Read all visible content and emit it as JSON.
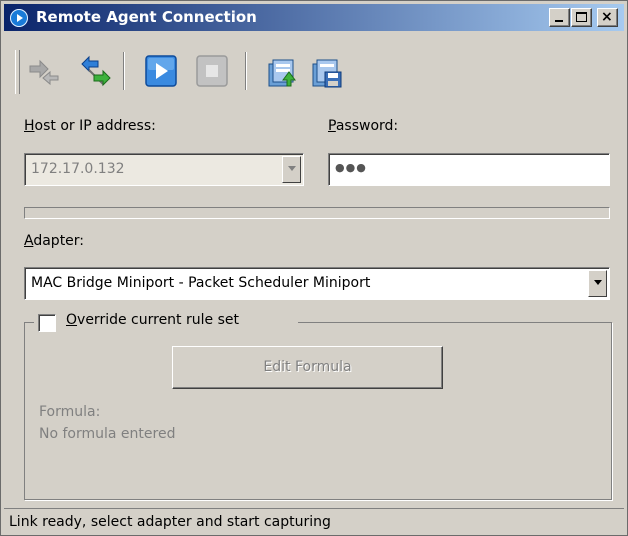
{
  "window": {
    "title": "Remote Agent Connection",
    "title_icon": "remote-agent-icon",
    "controls": {
      "minimize": "minimize-icon",
      "maximize": "maximize-icon",
      "close_glyph": "×"
    }
  },
  "toolbar": {
    "buttons": [
      {
        "name": "disconnect",
        "icon": "disconnect-arrows-icon",
        "enabled": false
      },
      {
        "name": "connect",
        "icon": "connect-arrows-icon",
        "enabled": true
      },
      {
        "name": "start-capture",
        "icon": "play-icon",
        "enabled": true
      },
      {
        "name": "stop-capture",
        "icon": "stop-icon",
        "enabled": false
      },
      {
        "name": "load-settings",
        "icon": "open-settings-icon",
        "enabled": true
      },
      {
        "name": "save-settings",
        "icon": "save-settings-icon",
        "enabled": true
      }
    ]
  },
  "host": {
    "label_accel": "H",
    "label_rest": "ost or IP address:",
    "value": "172.17.0.132",
    "enabled": false
  },
  "password": {
    "label_accel": "P",
    "label_rest": "assword:",
    "value": "●●●"
  },
  "adapter": {
    "label_accel": "A",
    "label_rest": "dapter:",
    "selected": "MAC Bridge Miniport - Packet Scheduler Miniport"
  },
  "override": {
    "label_accel": "O",
    "label_rest": "verride current rule set",
    "checked": false
  },
  "formula": {
    "button_label": "Edit Formula",
    "caption": "Formula:",
    "value": "No formula entered"
  },
  "status": {
    "text": "Link ready, select adapter and start capturing"
  },
  "colors": {
    "title_start": "#0a246a",
    "title_end": "#a6caf0",
    "face": "#d4d0c8",
    "accent_blue": "#1f6fd0",
    "accent_green": "#2fa52f"
  }
}
